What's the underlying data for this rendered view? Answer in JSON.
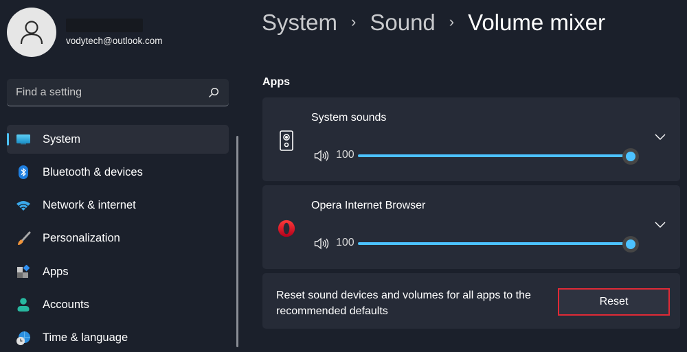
{
  "profile": {
    "name_redacted": true,
    "email": "vodytech@outlook.com"
  },
  "search": {
    "placeholder": "Find a setting",
    "value": ""
  },
  "sidebar": {
    "items": [
      {
        "label": "System",
        "icon": "monitor-icon",
        "active": true
      },
      {
        "label": "Bluetooth & devices",
        "icon": "bluetooth-icon",
        "active": false
      },
      {
        "label": "Network & internet",
        "icon": "wifi-icon",
        "active": false
      },
      {
        "label": "Personalization",
        "icon": "paintbrush-icon",
        "active": false
      },
      {
        "label": "Apps",
        "icon": "apps-icon",
        "active": false
      },
      {
        "label": "Accounts",
        "icon": "person-icon",
        "active": false
      },
      {
        "label": "Time & language",
        "icon": "globe-clock-icon",
        "active": false
      }
    ]
  },
  "breadcrumb": {
    "items": [
      "System",
      "Sound",
      "Volume mixer"
    ],
    "separator": "›"
  },
  "main": {
    "section_title": "Apps",
    "apps": [
      {
        "name": "System sounds",
        "icon": "speaker-icon",
        "volume": 100
      },
      {
        "name": "Opera Internet Browser",
        "icon": "opera-icon",
        "volume": 100
      }
    ],
    "reset": {
      "description": "Reset sound devices and volumes for all apps to the recommended defaults",
      "button_label": "Reset"
    }
  },
  "colors": {
    "accent": "#4cc2ff",
    "highlight_border": "#e02a36",
    "background": "#1b202b",
    "card": "#262b37"
  }
}
